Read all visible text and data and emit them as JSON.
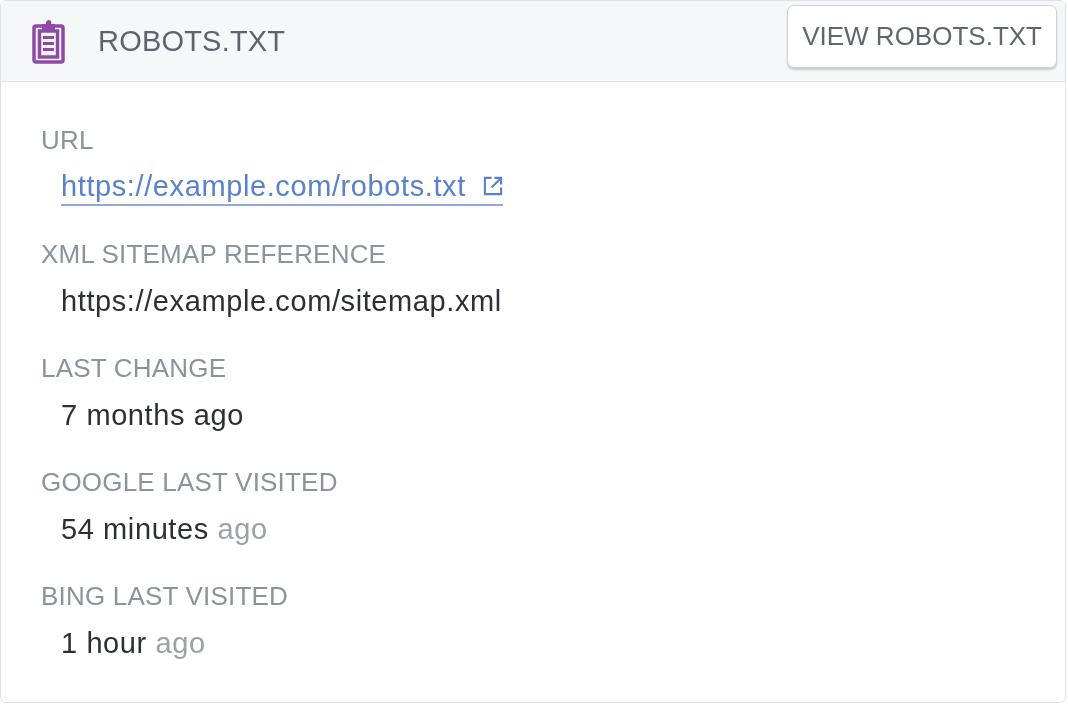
{
  "header": {
    "title": "ROBOTS.TXT",
    "button": "VIEW ROBOTS.TXT"
  },
  "fields": [
    {
      "label": "URL",
      "kind": "link",
      "value": "https://example.com/robots.txt"
    },
    {
      "label": "XML SITEMAP REFERENCE",
      "kind": "text",
      "value": "https://example.com/sitemap.xml"
    },
    {
      "label": "LAST CHANGE",
      "kind": "text",
      "value": "7 months ago"
    },
    {
      "label": "GOOGLE LAST VISITED",
      "kind": "relative",
      "value": "54 minutes",
      "suffix": "ago"
    },
    {
      "label": "BING LAST VISITED",
      "kind": "relative",
      "value": "1 hour",
      "suffix": "ago"
    }
  ]
}
